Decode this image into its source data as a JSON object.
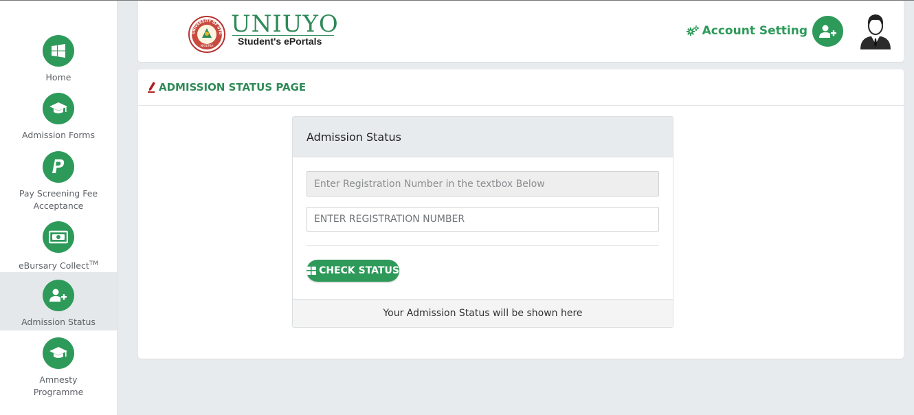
{
  "brand": {
    "name": "UNIUYO",
    "subtitle": "Student's ePortals",
    "seal_text": "UNIVERSITY OF UYO",
    "seal_bottom": "NIGERIA"
  },
  "header": {
    "account_setting": "Account Setting"
  },
  "sidebar": {
    "items": [
      {
        "label": "Home",
        "icon": "windows-icon"
      },
      {
        "label": "Admission Forms",
        "icon": "graduation-cap-icon"
      },
      {
        "label_line1": "Pay Screening Fee",
        "label_line2": "Acceptance",
        "icon": "paypal-icon"
      },
      {
        "label": "eBursary Collect",
        "sup": "TM",
        "icon": "money-bill-icon"
      },
      {
        "label": "Admission Status",
        "icon": "user-plus-icon"
      },
      {
        "label_line1": "Amnesty",
        "label_line2": "Programme",
        "icon": "graduation-cap-icon"
      }
    ]
  },
  "page": {
    "title": "ADMISSION STATUS PAGE"
  },
  "panel": {
    "heading": "Admission Status",
    "info_text": "Enter Registration Number in the textbox Below",
    "input_placeholder": "ENTER REGISTRATION NUMBER",
    "input_value": "",
    "button_label": "CHECK STATUS",
    "footer_text": "Your Admission Status will be shown here"
  },
  "colors": {
    "accent": "#2e9a5a",
    "title_green": "#2e8a57",
    "background": "#e8ebee"
  }
}
